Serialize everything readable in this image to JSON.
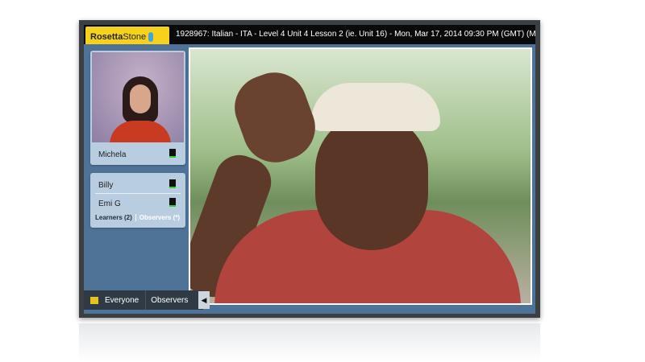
{
  "header": {
    "logo_bold": "Rosetta",
    "logo_light": "Stone",
    "title": "1928967: Italian - ITA - Level 4 Unit 4 Lesson 2 (ie. Unit 16) - Mon, Mar 17, 2014 09:30 PM (GMT) (Mid"
  },
  "coach": {
    "name": "Michela"
  },
  "participants": [
    {
      "name": "Billy"
    },
    {
      "name": "Emi G"
    }
  ],
  "tabs": {
    "learners": "Learners (2)",
    "observers": "Observers (*)"
  },
  "bottom": {
    "everyone": "Everyone",
    "observers": "Observers",
    "collapse": "◀"
  }
}
